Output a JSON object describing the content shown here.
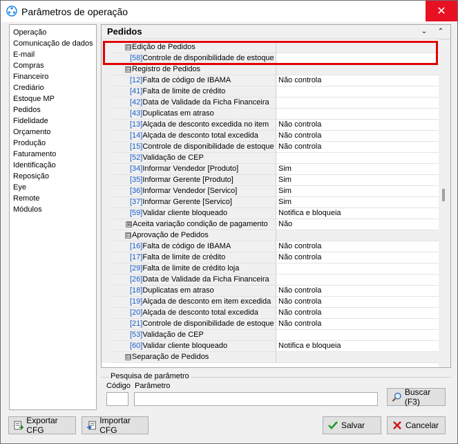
{
  "window": {
    "title": "Parâmetros de operação",
    "close_glyph": "✕"
  },
  "sidebar": {
    "items": [
      "Operação",
      "Comunicação de dados",
      "E-mail",
      "Compras",
      "Financeiro",
      "Crediário",
      "Estoque MP",
      "Pedidos",
      "Fidelidade",
      "Orçamento",
      "Produção",
      "Faturamento",
      "Identificação",
      "Reposição",
      "Eye",
      "Remote",
      "Módulos"
    ]
  },
  "panel": {
    "title": "Pedidos",
    "collapse_glyph": "⌄",
    "expand_glyph": "⌃",
    "rows": [
      {
        "type": "cat",
        "expander": "⊟",
        "name": "Edição de Pedidos",
        "value": ""
      },
      {
        "type": "param",
        "code": "[58]",
        "name": "Controle de disponibilidade de estoque",
        "value": ""
      },
      {
        "type": "cat",
        "expander": "⊟",
        "name": "Registro de Pedidos",
        "value": ""
      },
      {
        "type": "param",
        "code": "[12]",
        "name": "Falta de código de IBAMA",
        "value": "Não controla"
      },
      {
        "type": "param",
        "code": "[41]",
        "name": "Falta de limite de crédito",
        "value": ""
      },
      {
        "type": "param",
        "code": "[42]",
        "name": "Data de Validade da Ficha Financeira",
        "value": ""
      },
      {
        "type": "param",
        "code": "[43]",
        "name": "Duplicatas em atraso",
        "value": ""
      },
      {
        "type": "param",
        "code": "[13]",
        "name": "Alçada de desconto excedida no item",
        "value": "Não controla"
      },
      {
        "type": "param",
        "code": "[14]",
        "name": "Alçada de desconto total excedida",
        "value": "Não controla"
      },
      {
        "type": "param",
        "code": "[15]",
        "name": "Controle de disponibilidade de estoque",
        "value": "Não controla"
      },
      {
        "type": "param",
        "code": "[52]",
        "name": "Validação de CEP",
        "value": ""
      },
      {
        "type": "param",
        "code": "[34]",
        "name": "Informar Vendedor [Produto]",
        "value": "Sim"
      },
      {
        "type": "param",
        "code": "[35]",
        "name": "Informar Gerente [Produto]",
        "value": "Sim"
      },
      {
        "type": "param",
        "code": "[36]",
        "name": "Informar Vendedor [Servico]",
        "value": "Sim"
      },
      {
        "type": "param",
        "code": "[37]",
        "name": "Informar Gerente [Servico]",
        "value": "Sim"
      },
      {
        "type": "param",
        "code": "[59]",
        "name": "Validar cliente bloqueado",
        "value": "Notifica e bloqueia"
      },
      {
        "type": "sub",
        "expander": "⊞",
        "name": "Aceita variação condição de pagamento",
        "value": "Não"
      },
      {
        "type": "cat",
        "expander": "⊟",
        "name": "Aprovação de Pedidos",
        "value": ""
      },
      {
        "type": "param",
        "code": "[16]",
        "name": "Falta de código de IBAMA",
        "value": "Não controla"
      },
      {
        "type": "param",
        "code": "[17]",
        "name": "Falta de limite de crédito",
        "value": "Não controla"
      },
      {
        "type": "param",
        "code": "[29]",
        "name": "Falta de limite de crédito loja",
        "value": ""
      },
      {
        "type": "param",
        "code": "[26]",
        "name": "Data de Validade da Ficha Financeira",
        "value": ""
      },
      {
        "type": "param",
        "code": "[18]",
        "name": "Duplicatas em atraso",
        "value": "Não controla"
      },
      {
        "type": "param",
        "code": "[19]",
        "name": "Alçada de desconto em item excedida",
        "value": "Não controla"
      },
      {
        "type": "param",
        "code": "[20]",
        "name": "Alçada de desconto total excedida",
        "value": "Não controla"
      },
      {
        "type": "param",
        "code": "[21]",
        "name": "Controle de disponibilidade de estoque",
        "value": "Não controla"
      },
      {
        "type": "param",
        "code": "[53]",
        "name": "Validação de CEP",
        "value": ""
      },
      {
        "type": "param",
        "code": "[60]",
        "name": "Validar cliente bloqueado",
        "value": "Notifica e bloqueia"
      },
      {
        "type": "cat",
        "expander": "⊟",
        "name": "Separação de Pedidos",
        "value": ""
      }
    ]
  },
  "search": {
    "group_title": "Pesquisa de parâmetro",
    "codigo_label": "Código",
    "parametro_label": "Parâmetro",
    "codigo_value": "",
    "parametro_value": "",
    "buscar_label": "Buscar (F3)"
  },
  "footer": {
    "exportar_label": "Exportar CFG",
    "importar_label": "Importar CFG",
    "salvar_label": "Salvar",
    "cancelar_label": "Cancelar"
  },
  "colors": {
    "highlight": "#e00000",
    "code": "#1a5dc7",
    "close": "#e81123"
  }
}
